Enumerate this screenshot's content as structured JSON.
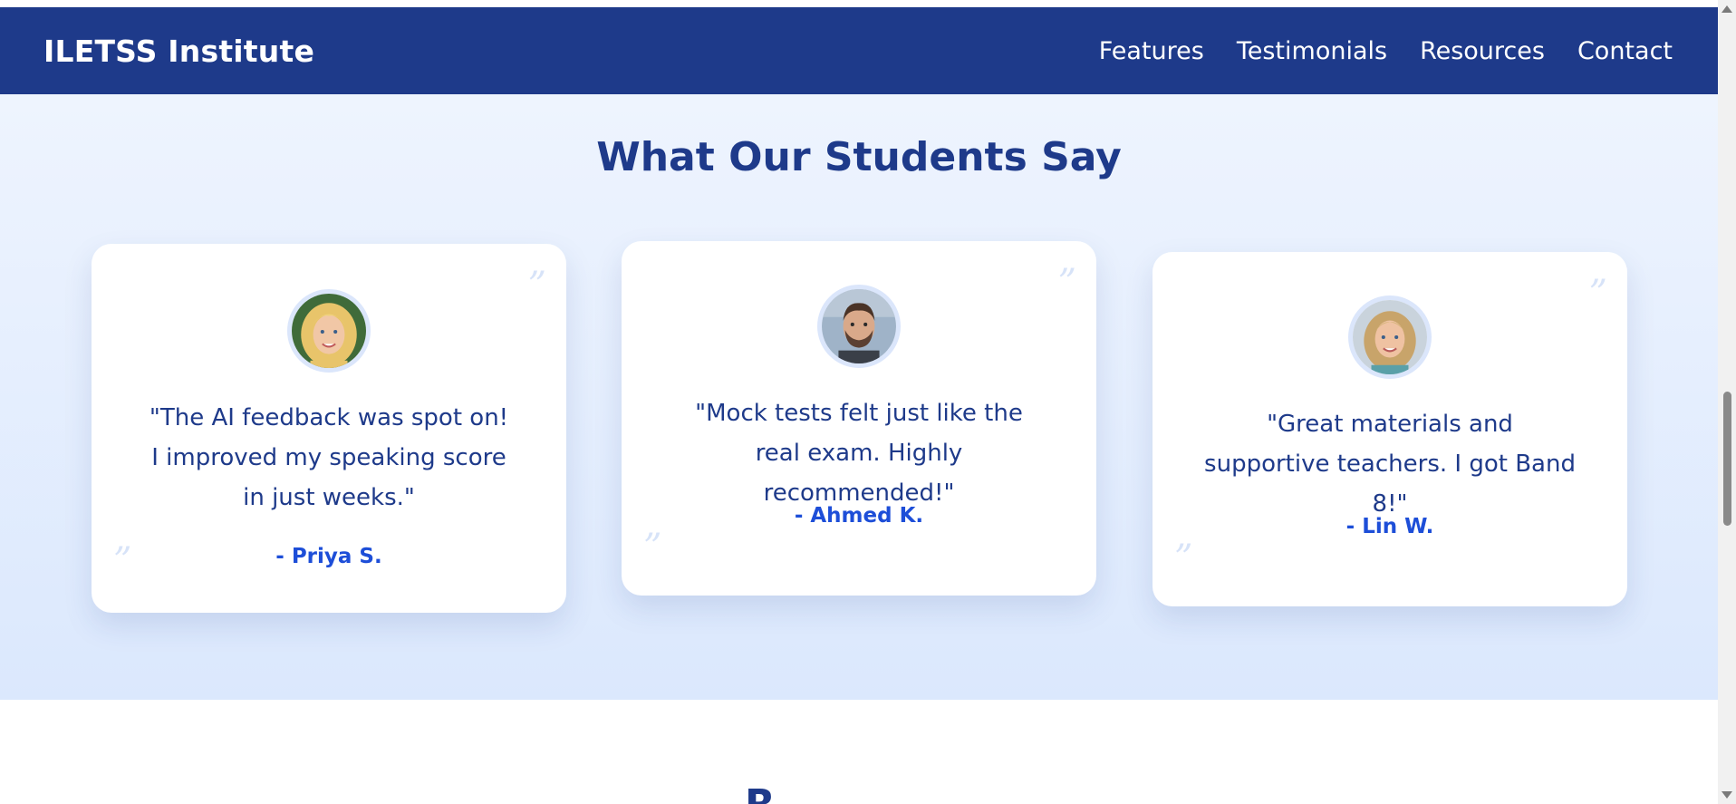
{
  "navbar": {
    "brand": "ILETSS Institute",
    "links": [
      "Features",
      "Testimonials",
      "Resources",
      "Contact"
    ]
  },
  "testimonials": {
    "title": "What Our Students Say",
    "quote_mark": "”",
    "items": [
      {
        "text": "\"The AI feedback was spot on! I improved my speaking score in just weeks.\"",
        "author": "- Priya S."
      },
      {
        "text": "\"Mock tests felt just like the real exam. Highly recommended!\"",
        "author": "- Ahmed K."
      },
      {
        "text": "\"Great materials and supportive teachers. I got Band 8!\"",
        "author": "- Lin W."
      }
    ]
  },
  "next_section": {
    "title_fragment": "R"
  },
  "colors": {
    "navbar": "#1e3a8a",
    "title": "#1e3a8a",
    "author": "#1d4ed8",
    "section_bg_top": "#eef4fe",
    "section_bg_bottom": "#dbe8fd"
  }
}
